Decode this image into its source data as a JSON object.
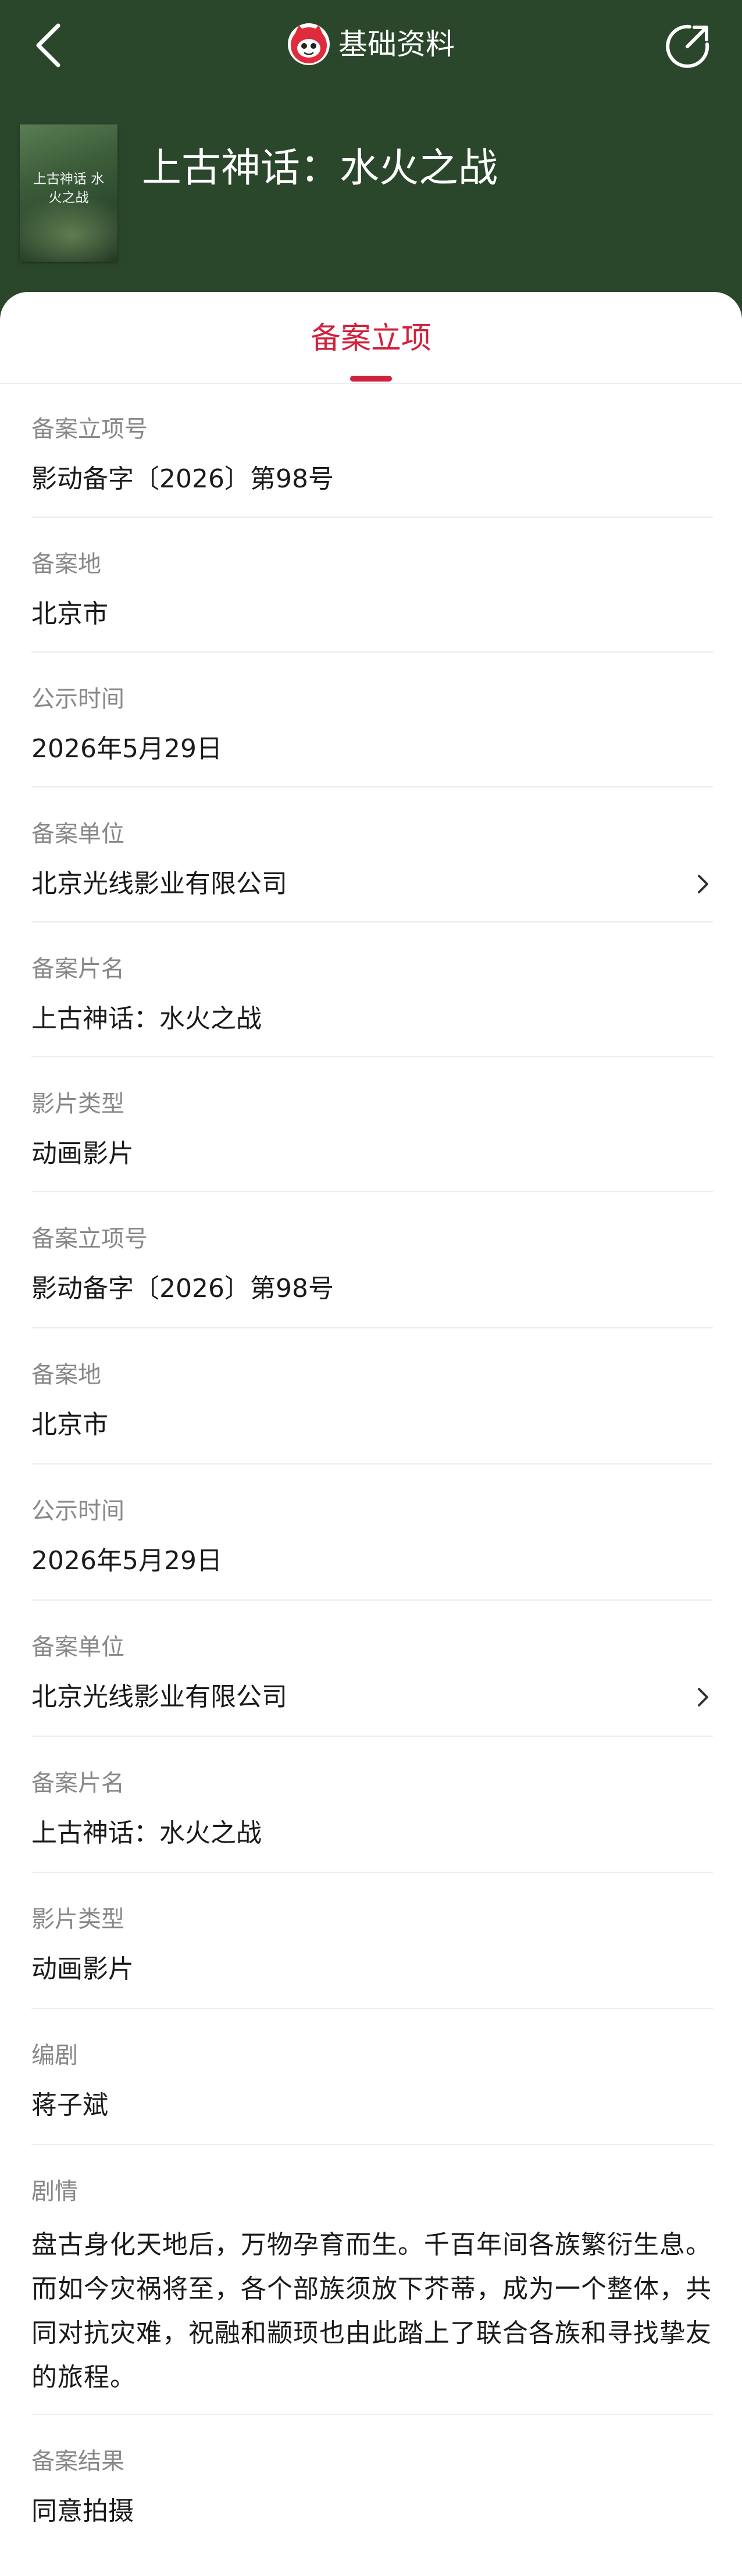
{
  "header": {
    "title": "基础资料",
    "movie_name": "上古神话：水火之战",
    "poster_text": "上古神话 水火之战",
    "bg_color": "#2b472b"
  },
  "tabs": [
    {
      "label": "备案立项",
      "active": true
    }
  ],
  "accent_color": "#d0223c",
  "rows": [
    {
      "label": "备案立项号",
      "value": "影动备字〔2026〕第98号"
    },
    {
      "label": "备案地",
      "value": "北京市"
    },
    {
      "label": "公示时间",
      "value": "2026年5月29日"
    },
    {
      "label": "备案单位",
      "value": "北京光线影业有限公司",
      "link": true
    },
    {
      "label": "备案片名",
      "value": "上古神话：水火之战"
    },
    {
      "label": "影片类型",
      "value": "动画影片"
    },
    {
      "label": "备案立项号",
      "value": "影动备字〔2026〕第98号"
    },
    {
      "label": "备案地",
      "value": "北京市"
    },
    {
      "label": "公示时间",
      "value": "2026年5月29日"
    },
    {
      "label": "备案单位",
      "value": "北京光线影业有限公司",
      "link": true
    },
    {
      "label": "备案片名",
      "value": "上古神话：水火之战"
    },
    {
      "label": "影片类型",
      "value": "动画影片"
    },
    {
      "label": "编剧",
      "value": "蒋子斌"
    },
    {
      "label": "剧情",
      "value": "盘古身化天地后，万物孕育而生。千百年间各族繁衍生息。而如今灾祸将至，各个部族须放下芥蒂，成为一个整体，共同对抗灾难，祝融和颛顼也由此踏上了联合各族和寻找挚友的旅程。"
    },
    {
      "label": "备案结果",
      "value": "同意拍摄"
    }
  ],
  "icons": {
    "back": "back-arrow-icon",
    "share": "share-icon",
    "logo": "cat-logo-icon",
    "chevron": "chevron-right-icon"
  }
}
